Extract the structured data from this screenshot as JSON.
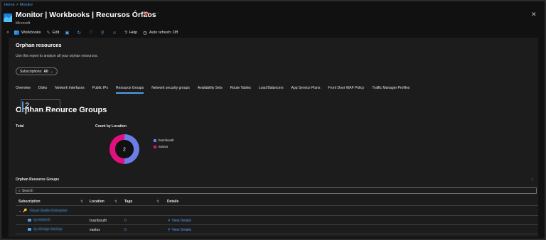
{
  "breadcrumb": {
    "home": "Home",
    "current": "Monitor"
  },
  "header": {
    "title": "Monitor | Workbooks | Recursos Órfãos",
    "subtitle": "Microsoft",
    "pin_icon": "pin-icon",
    "more": "···",
    "close": "✕"
  },
  "toolbar": {
    "items": [
      {
        "icon": "workbooks-icon",
        "label": "Workbooks"
      },
      {
        "icon": "edit-icon",
        "label": "Edit"
      },
      {
        "icon": "save-icon",
        "label": ""
      },
      {
        "icon": "refresh-icon",
        "label": ""
      },
      {
        "icon": "feedback-icon",
        "label": ""
      },
      {
        "icon": "pin-icon",
        "label": ""
      },
      {
        "icon": "smiley-icon",
        "label": ""
      },
      {
        "icon": "help-icon",
        "label": "Help"
      },
      {
        "icon": "auto-refresh-icon",
        "label": "Auto refresh: Off"
      }
    ]
  },
  "report": {
    "title": "Orphan resources",
    "description": "Use this report to analyze all your orphan resources.",
    "param": {
      "label": "Subscriptions:",
      "value": "All"
    }
  },
  "tabs": [
    {
      "label": "Overview",
      "active": false
    },
    {
      "label": "Disks",
      "active": false
    },
    {
      "label": "Network Interfaces",
      "active": false
    },
    {
      "label": "Public IPs",
      "active": false
    },
    {
      "label": "Resource Groups",
      "active": true
    },
    {
      "label": "Network security groups",
      "active": false
    },
    {
      "label": "Availability Sets",
      "active": false
    },
    {
      "label": "Route Tables",
      "active": false
    },
    {
      "label": "Load Balancers",
      "active": false
    },
    {
      "label": "App Service Plans",
      "active": false
    },
    {
      "label": "Front Door WAF Policy",
      "active": false
    },
    {
      "label": "Traffic Manager Profiles",
      "active": false
    }
  ],
  "section_title": "Orphan Reource Groups",
  "total": {
    "label": "Total",
    "value": "2"
  },
  "location_chart": {
    "label": "Count by Location",
    "center": "2",
    "colors": {
      "brazilsouth": "#6b7ee8",
      "eastus": "#e0107c"
    }
  },
  "chart_data": {
    "type": "pie",
    "title": "Count by Location",
    "categories": [
      "brazilsouth",
      "eastus"
    ],
    "values": [
      1,
      1
    ],
    "legend_position": "right"
  },
  "grid": {
    "title": "Orphan Resource Groups",
    "download_icon": "download-icon",
    "search_placeholder": "Search",
    "columns": [
      "Subscription",
      "Location",
      "Tags",
      "Details"
    ],
    "group": {
      "name": "Visual Studio Enterprise"
    },
    "rows": [
      {
        "name": "rg-network",
        "location": "brazilsouth",
        "tags": "0",
        "details": "View Details"
      },
      {
        "name": "rg-storage-backup",
        "location": "eastus",
        "tags": "0",
        "details": "View Details"
      }
    ]
  }
}
